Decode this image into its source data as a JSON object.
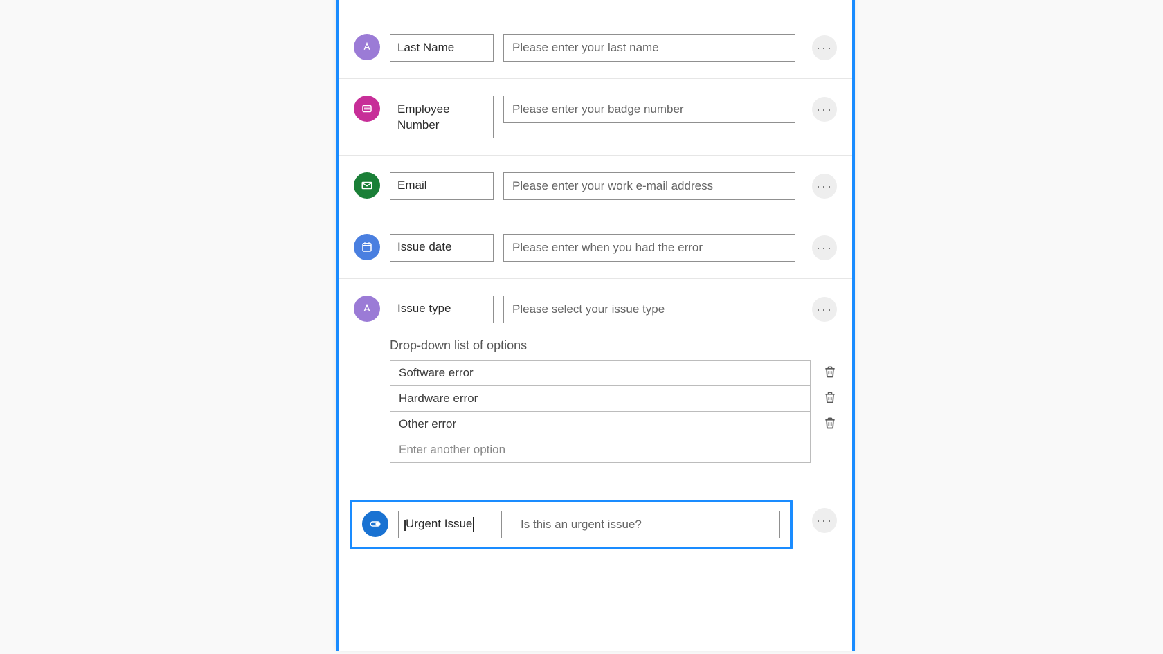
{
  "fields": [
    {
      "icon": "text",
      "icon_name": "text-icon",
      "badge": "purple",
      "label": "Last Name",
      "placeholder": "Please enter your last name",
      "multiline": false
    },
    {
      "icon": "number",
      "icon_name": "number-icon",
      "badge": "magenta",
      "label": "Employee Number",
      "placeholder": "Please enter your badge number",
      "multiline": true
    },
    {
      "icon": "email",
      "icon_name": "email-icon",
      "badge": "green",
      "label": "Email",
      "placeholder": "Please enter your work e-mail address",
      "multiline": false
    },
    {
      "icon": "calendar",
      "icon_name": "calendar-icon",
      "badge": "blue",
      "label": "Issue date",
      "placeholder": "Please enter when you had the error",
      "multiline": false
    },
    {
      "icon": "text",
      "icon_name": "text-icon",
      "badge": "purple",
      "label": "Issue type",
      "placeholder": "Please select your issue type",
      "multiline": false,
      "has_dropdown": true
    }
  ],
  "dropdown": {
    "title": "Drop-down list of options",
    "options": [
      "Software error",
      "Hardware error",
      "Other error"
    ],
    "add_placeholder": "Enter another option"
  },
  "selected_field": {
    "icon": "toggle",
    "icon_name": "toggle-icon",
    "badge": "cyan",
    "label": "Urgent Issue",
    "placeholder": "Is this an urgent issue?"
  },
  "more_glyph": "···"
}
